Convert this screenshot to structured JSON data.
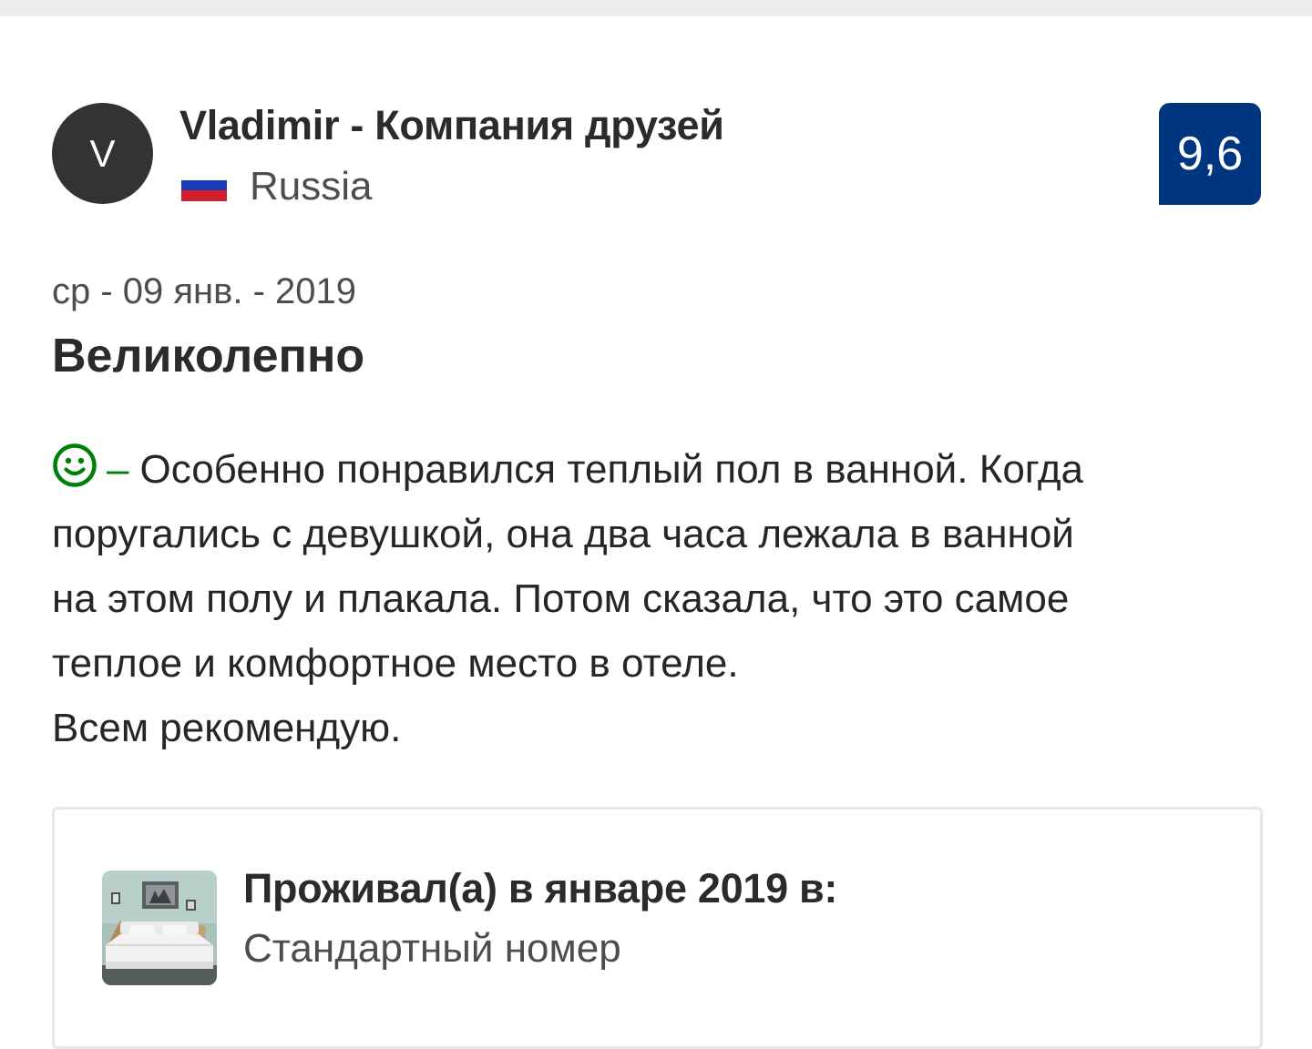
{
  "reviewer": {
    "initial": "V",
    "name": "Vladimir - Компания друзей",
    "country": "Russia",
    "flag_icon": "russia-flag-icon"
  },
  "score": "9,6",
  "colors": {
    "score_badge": "#003580",
    "positive_icon": "#008009",
    "avatar": "#333333"
  },
  "review": {
    "date": "ср - 09 янв. - 2019",
    "title": "Великолепно",
    "positive_icon": "smiley-icon",
    "positive_marker": "–",
    "lines": [
      "Особенно понравился теплый пол в ванной. Когда",
      "поругались с девушкой, она два часа лежала в ванной",
      "на этом полу и плакала. Потом сказала, что это самое",
      "теплое и комфортное место в отеле.",
      "Всем рекомендую."
    ]
  },
  "stay": {
    "heading": "Проживал(а) в январе 2019 в:",
    "room_type": "Стандартный номер",
    "thumbnail_icon": "room-photo"
  }
}
